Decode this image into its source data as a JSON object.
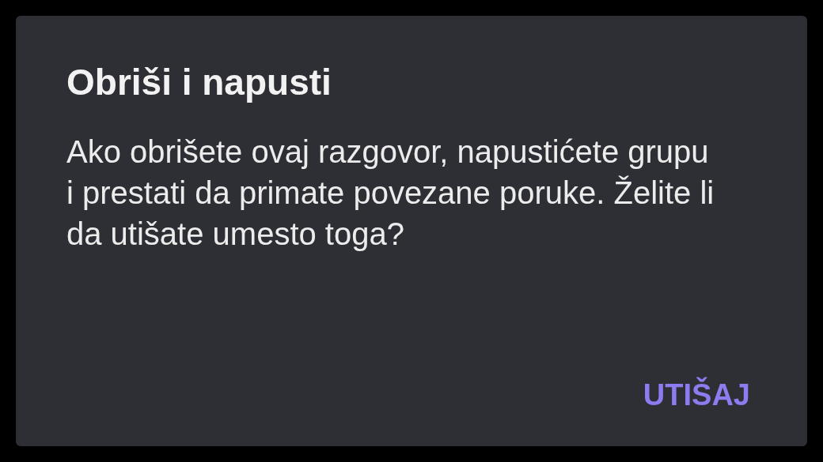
{
  "dialog": {
    "title": "Obriši i napusti",
    "message": "Ako obrišete ovaj razgovor, napustićete grupu i prestati da primate povezane poruke. Želite li da utišate umesto toga?",
    "buttons": [
      "UTIŠAJ"
    ]
  }
}
